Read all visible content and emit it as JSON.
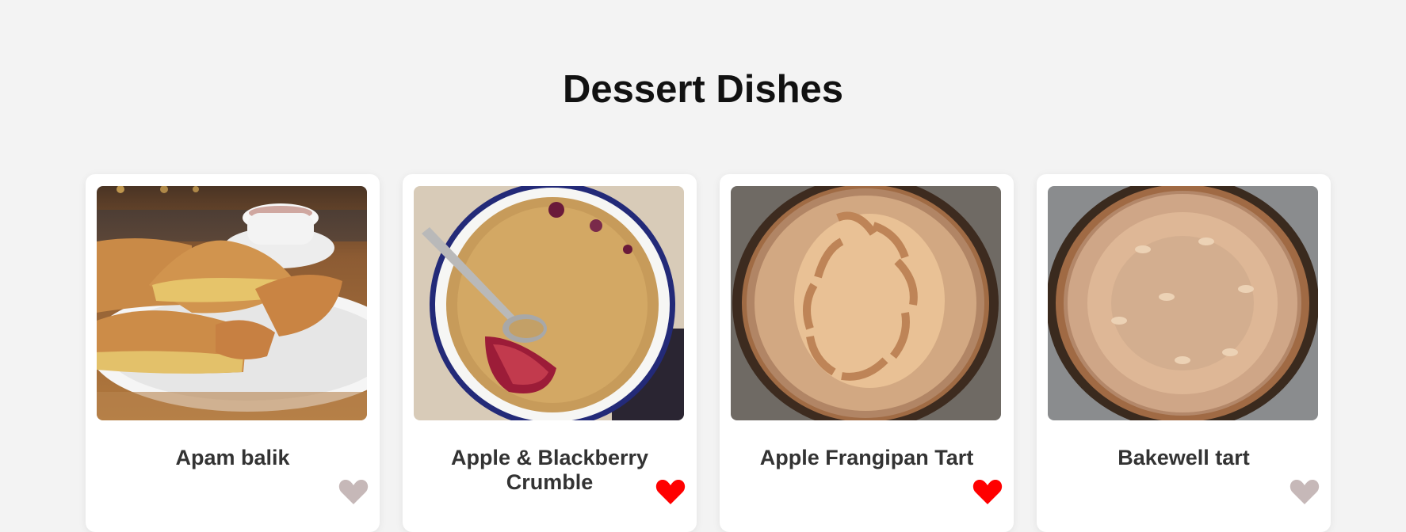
{
  "page": {
    "title": "Dessert Dishes"
  },
  "colors": {
    "background": "#f3f3f3",
    "card": "#ffffff",
    "heart_active": "#ff0000",
    "heart_inactive": "#c6b8b8"
  },
  "dishes": [
    {
      "title": "Apam balik",
      "favorite": false,
      "image": "apam-balik-photo"
    },
    {
      "title": "Apple & Blackberry Crumble",
      "favorite": true,
      "image": "apple-blackberry-crumble-photo"
    },
    {
      "title": "Apple Frangipan Tart",
      "favorite": true,
      "image": "apple-frangipan-tart-photo"
    },
    {
      "title": "Bakewell tart",
      "favorite": false,
      "image": "bakewell-tart-photo"
    }
  ]
}
